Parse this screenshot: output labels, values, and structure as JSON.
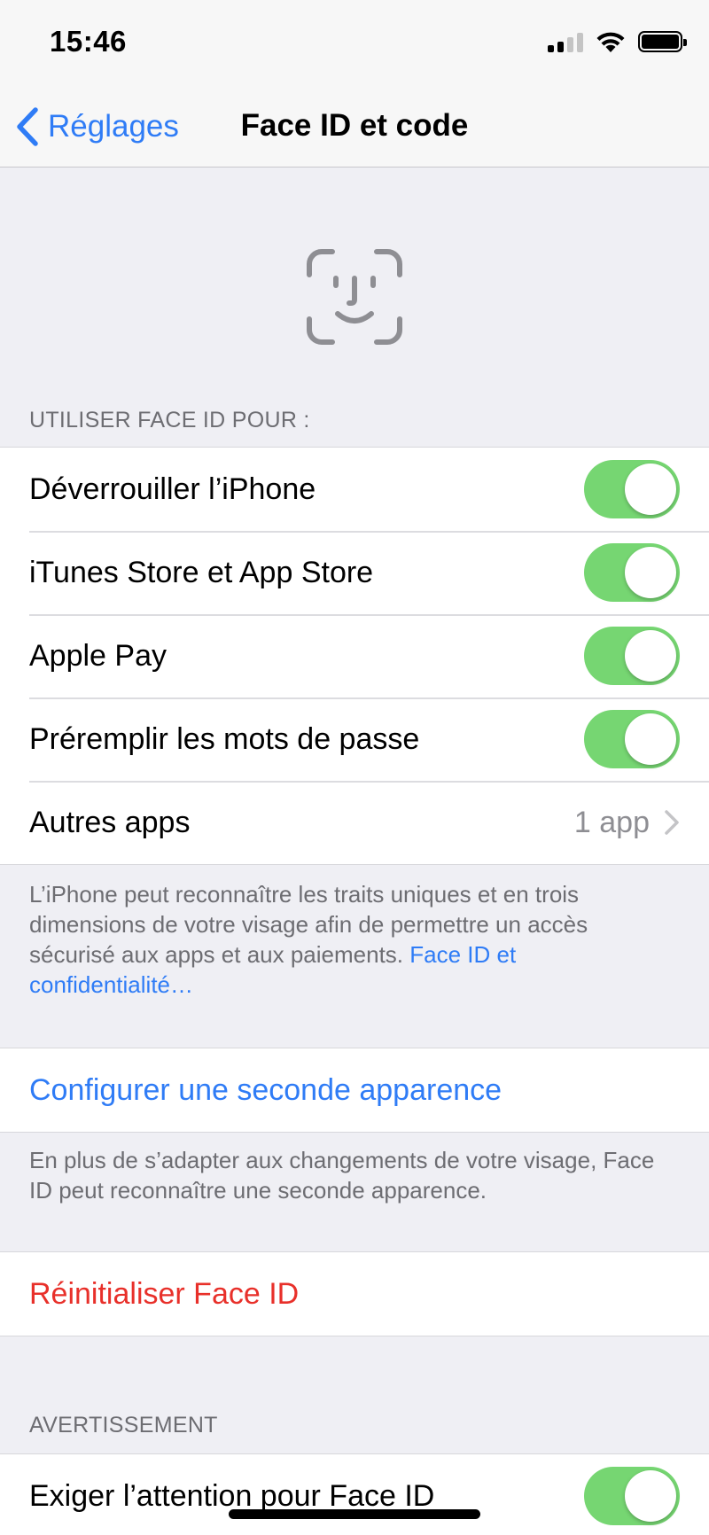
{
  "status_bar": {
    "time": "15:46"
  },
  "nav": {
    "back_label": "Réglages",
    "title": "Face ID et code"
  },
  "section_use": {
    "header": "UTILISER FACE ID POUR :",
    "rows": [
      {
        "label": "Déverrouiller l’iPhone",
        "on": true
      },
      {
        "label": "iTunes Store et App Store",
        "on": true
      },
      {
        "label": "Apple Pay",
        "on": true
      },
      {
        "label": "Préremplir les mots de passe",
        "on": true
      }
    ],
    "other_apps": {
      "label": "Autres apps",
      "value": "1 app"
    },
    "footer_text": "L’iPhone peut reconnaître les traits uniques et en trois dimensions de votre visage afin de permettre un accès sécurisé aux apps et aux paiements.",
    "footer_link": "Face ID et confidentialité…"
  },
  "alt_appearance": {
    "label": "Configurer une seconde apparence",
    "footer_text": "En plus de s’adapter aux changements de votre visage, Face ID peut reconnaître une seconde apparence."
  },
  "reset": {
    "label": "Réinitialiser Face ID"
  },
  "section_warning": {
    "header": "AVERTISSEMENT",
    "row": {
      "label": "Exiger l’attention pour Face ID",
      "on": true
    }
  },
  "colors": {
    "accent": "#2f7cf6",
    "destructive": "#e8302a",
    "toggle_on": "#76d672"
  }
}
